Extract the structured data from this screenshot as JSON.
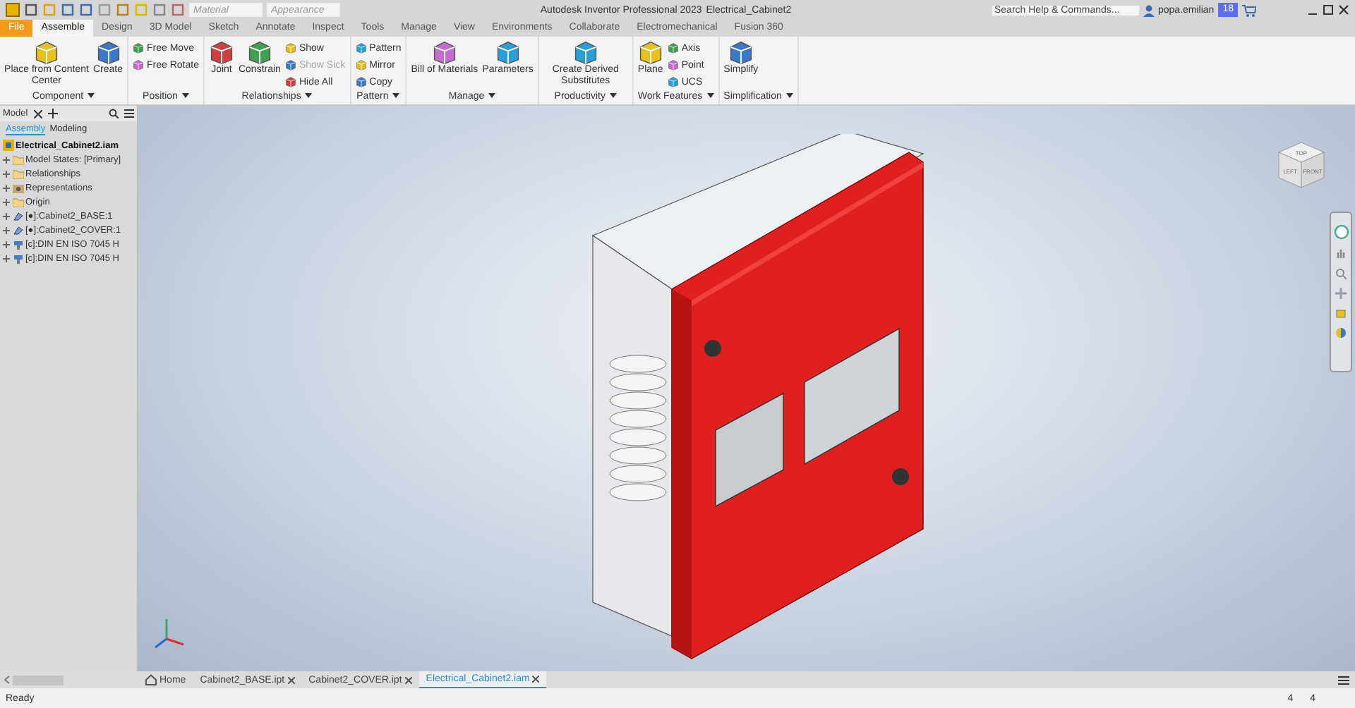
{
  "title_bar": {
    "material": {
      "placeholder": "Material"
    },
    "appearance": {
      "placeholder": "Appearance"
    },
    "app_title": "Autodesk Inventor Professional 2023",
    "document_title": "Electrical_Cabinet2",
    "search": {
      "placeholder": "Search Help & Commands..."
    },
    "user": "popa.emilian",
    "notifications": "18"
  },
  "menu_tabs": [
    {
      "label": "File",
      "kind": "file",
      "selected": false
    },
    {
      "label": "Assemble",
      "kind": "tab",
      "selected": true
    },
    {
      "label": "Design",
      "kind": "tab",
      "selected": false
    },
    {
      "label": "3D Model",
      "kind": "tab",
      "selected": false
    },
    {
      "label": "Sketch",
      "kind": "tab",
      "selected": false
    },
    {
      "label": "Annotate",
      "kind": "tab",
      "selected": false
    },
    {
      "label": "Inspect",
      "kind": "tab",
      "selected": false
    },
    {
      "label": "Tools",
      "kind": "tab",
      "selected": false
    },
    {
      "label": "Manage",
      "kind": "tab",
      "selected": false
    },
    {
      "label": "View",
      "kind": "tab",
      "selected": false
    },
    {
      "label": "Environments",
      "kind": "tab",
      "selected": false
    },
    {
      "label": "Collaborate",
      "kind": "tab",
      "selected": false
    },
    {
      "label": "Electromechanical",
      "kind": "tab",
      "selected": false
    },
    {
      "label": "Fusion 360",
      "kind": "tab",
      "selected": false
    }
  ],
  "ribbon_groups": [
    {
      "label": "Component",
      "items": [
        {
          "kind": "large",
          "label": "Place from Content Center",
          "disabled": false
        },
        {
          "kind": "large",
          "label": "Create",
          "disabled": false
        }
      ]
    },
    {
      "label": "Position",
      "items": [
        {
          "kind": "small",
          "label": "Free Move",
          "disabled": false
        },
        {
          "kind": "small",
          "label": "Free Rotate",
          "disabled": false
        }
      ]
    },
    {
      "label": "Relationships",
      "items": [
        {
          "kind": "large",
          "label": "Joint",
          "disabled": false
        },
        {
          "kind": "large",
          "label": "Constrain",
          "disabled": false
        },
        {
          "kind": "small",
          "label": "Show",
          "disabled": false
        },
        {
          "kind": "small",
          "label": "Show Sick",
          "disabled": true
        },
        {
          "kind": "small",
          "label": "Hide All",
          "disabled": false
        }
      ]
    },
    {
      "label": "Pattern",
      "items": [
        {
          "kind": "small",
          "label": "Pattern",
          "disabled": false
        },
        {
          "kind": "small",
          "label": "Mirror",
          "disabled": false
        },
        {
          "kind": "small",
          "label": "Copy",
          "disabled": false
        }
      ]
    },
    {
      "label": "Manage",
      "items": [
        {
          "kind": "large",
          "label": "Bill of Materials",
          "disabled": false
        },
        {
          "kind": "large",
          "label": "Parameters",
          "disabled": false
        }
      ]
    },
    {
      "label": "Productivity",
      "items": [
        {
          "kind": "large",
          "label": "Create Derived Substitutes",
          "disabled": false
        }
      ]
    },
    {
      "label": "Work Features",
      "items": [
        {
          "kind": "large",
          "label": "Plane",
          "disabled": false
        },
        {
          "kind": "small",
          "label": "Axis",
          "disabled": false
        },
        {
          "kind": "small",
          "label": "Point",
          "disabled": false
        },
        {
          "kind": "small",
          "label": "UCS",
          "disabled": false
        }
      ]
    },
    {
      "label": "Simplification",
      "items": [
        {
          "kind": "large",
          "label": "Simplify",
          "disabled": false
        }
      ]
    }
  ],
  "browser": {
    "tab": "Model",
    "subtabs": [
      {
        "label": "Assembly",
        "selected": true
      },
      {
        "label": "Modeling",
        "selected": false
      }
    ],
    "root": "Electrical_Cabinet2.iam",
    "tree": [
      {
        "kind": "folder",
        "label": "Model States: [Primary]",
        "expanded": false
      },
      {
        "kind": "folder",
        "label": "Relationships",
        "expanded": false
      },
      {
        "kind": "representations",
        "label": "Representations",
        "expanded": false
      },
      {
        "kind": "folder",
        "label": "Origin",
        "expanded": false
      },
      {
        "kind": "part",
        "label": "[●]:Cabinet2_BASE:1",
        "expanded": false
      },
      {
        "kind": "part",
        "label": "[●]:Cabinet2_COVER:1",
        "expanded": false
      },
      {
        "kind": "content",
        "label": "[c]:DIN EN ISO 7045 H",
        "expanded": false
      },
      {
        "kind": "content",
        "label": "[c]:DIN EN ISO 7045 H",
        "expanded": false
      }
    ]
  },
  "view_cube": {
    "top": "TOP",
    "left": "LEFT",
    "front": "FRONT"
  },
  "document_tabs": [
    {
      "kind": "home",
      "label": "Home",
      "selected": false
    },
    {
      "kind": "doc",
      "label": "Cabinet2_BASE.ipt",
      "selected": false
    },
    {
      "kind": "doc",
      "label": "Cabinet2_COVER.ipt",
      "selected": false
    },
    {
      "kind": "doc",
      "label": "Electrical_Cabinet2.iam",
      "selected": true
    }
  ],
  "status_bar": {
    "message": "Ready",
    "count_1": "4",
    "count_2": "4"
  }
}
